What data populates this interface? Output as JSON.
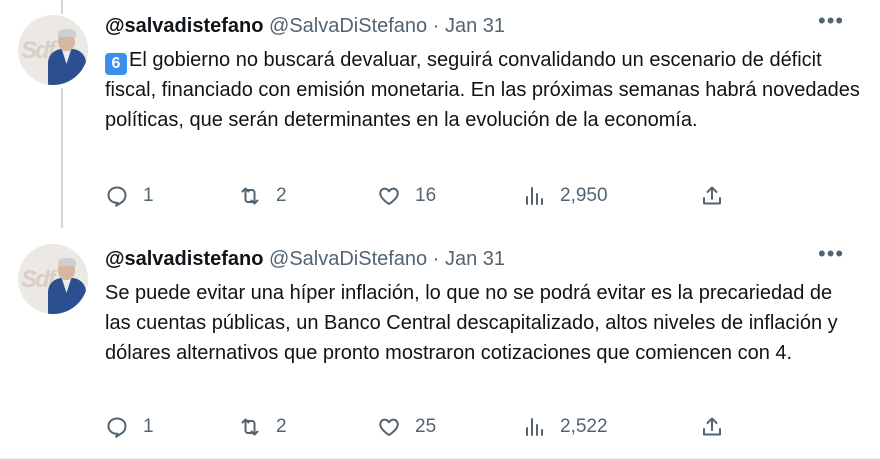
{
  "tweets": [
    {
      "username": "@salvadistefano",
      "handle": "@SalvaDiStefano",
      "separator": "·",
      "date": "Jan 31",
      "number_emoji": "6",
      "text": "El gobierno no buscará devaluar, seguirá convalidando un escenario de déficit fiscal, financiado con emisión monetaria. En las próximas semanas habrá novedades políticas, que serán determinantes en la evolución de la economía.",
      "replies": "1",
      "retweets": "2",
      "likes": "16",
      "views": "2,950",
      "more_label": "•••"
    },
    {
      "username": "@salvadistefano",
      "handle": "@SalvaDiStefano",
      "separator": "·",
      "date": "Jan 31",
      "text": "Se puede evitar una híper inflación, lo que no se podrá evitar es la precariedad de las cuentas públicas, un Banco Central descapitalizado, altos niveles de inflación y dólares alternativos que pronto mostraron cotizaciones que comiencen con 4.",
      "replies": "1",
      "retweets": "2",
      "likes": "25",
      "views": "2,522",
      "more_label": "•••"
    }
  ],
  "avatar_logo": "Sdf",
  "colors": {
    "text": "#0f1419",
    "secondary": "#536471",
    "thread_line": "#cfd9de",
    "keycap": "#3b8eea"
  },
  "icons": [
    "reply-icon",
    "retweet-icon",
    "like-icon",
    "views-icon",
    "share-icon",
    "more-icon"
  ]
}
